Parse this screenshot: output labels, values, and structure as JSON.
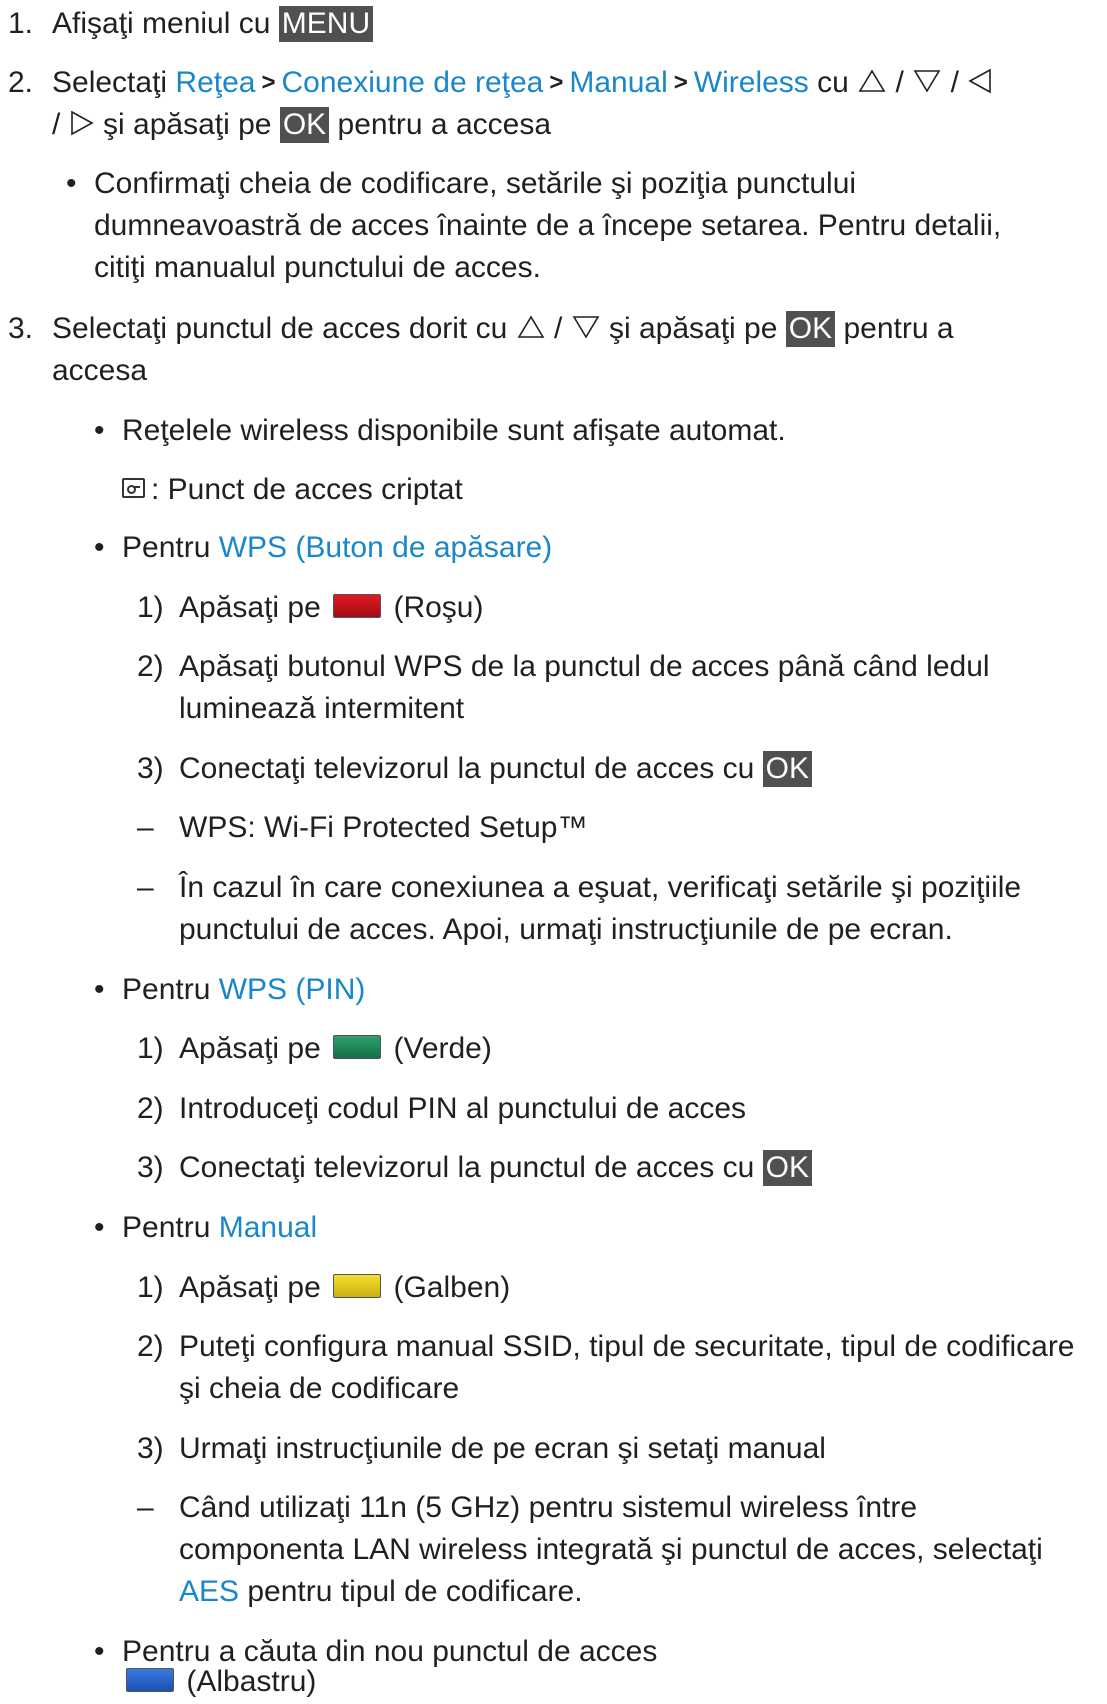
{
  "step1": {
    "num": "1.",
    "text": "Afişaţi meniul cu",
    "key": "MENU"
  },
  "step2": {
    "num": "2.",
    "prefix": "Selectaţi",
    "path": [
      "Reţea",
      "Conexiune de reţea",
      "Manual",
      "Wireless"
    ],
    "sep": ">",
    "cu": "cu",
    "slash": "/",
    "line2_pre": "şi apăsaţi pe",
    "ok": "OK",
    "line2_post": "pentru a accesa",
    "bullet": {
      "mark": "•",
      "lines": [
        "Confirmaţi cheia de codificare, setările şi poziţia punctului",
        "dumneavoastră de acces înainte de a începe setarea. Pentru detalii,",
        "citiţi manualul punctului de acces."
      ]
    }
  },
  "step3": {
    "num": "3.",
    "pre": "Selectaţi punctul de acces dorit cu",
    "slash": "/",
    "mid": "şi apăsaţi pe",
    "ok": "OK",
    "post": "pentru a",
    "line2": "accesa",
    "bullet_mark": "•",
    "dash_mark": "–",
    "b1": "Reţelele wireless disponibile sunt afişate automat.",
    "b1_sub": ": Punct de acces criptat",
    "b2_pre": "Pentru",
    "b2_link": "WPS (Buton de apăsare)",
    "b2_s1_num": "1)",
    "b2_s1_pre": "Apăsaţi pe",
    "b2_s1_post": "(Roşu)",
    "b2_s2_num": "2)",
    "b2_s2_l1": "Apăsaţi butonul WPS de la punctul de acces până când ledul",
    "b2_s2_l2": "luminează intermitent",
    "b2_s3_num": "3)",
    "b2_s3_pre": "Conectaţi televizorul la punctul de acces cu",
    "b2_s3_ok": "OK",
    "b2_d1": "WPS: Wi-Fi Protected Setup™",
    "b2_d2_l1": "În cazul în care conexiunea a eşuat, verificaţi setările şi poziţiile",
    "b2_d2_l2": "punctului de acces. Apoi, urmaţi instrucţiunile de pe ecran.",
    "b3_pre": "Pentru",
    "b3_link": "WPS (PIN)",
    "b3_s1_num": "1)",
    "b3_s1_pre": "Apăsaţi pe",
    "b3_s1_post": "(Verde)",
    "b3_s2_num": "2)",
    "b3_s2": "Introduceţi codul PIN al punctului de acces",
    "b3_s3_num": "3)",
    "b3_s3_pre": "Conectaţi televizorul la punctul de acces cu",
    "b3_s3_ok": "OK",
    "b4_pre": "Pentru",
    "b4_link": "Manual",
    "b4_s1_num": "1)",
    "b4_s1_pre": "Apăsaţi pe",
    "b4_s1_post": "(Galben)",
    "b4_s2_num": "2)",
    "b4_s2_l1": "Puteţi configura manual SSID, tipul de securitate, tipul de codificare",
    "b4_s2_l2": "şi cheia de codificare",
    "b4_s3_num": "3)",
    "b4_s3": "Urmaţi instrucţiunile de pe ecran şi setaţi manual",
    "b4_d1_l1": "Când utilizaţi 11n (5 GHz) pentru sistemul wireless între",
    "b4_d1_l2": "componenta LAN wireless integrată şi punctul de acces, selectaţi",
    "b4_d1_l3_link": "AES",
    "b4_d1_l3_post": "pentru tipul de codificare.",
    "b5": "Pentru a căuta din nou punctul de acces",
    "b5_sub": "(Albastru)"
  },
  "colors": {
    "link": "#1a87c9",
    "key_bg": "#505050",
    "red_button": "#c8141c",
    "green_button": "#1f8a5a",
    "yellow_button": "#e8d020",
    "blue_button": "#2a6ad0"
  },
  "icons": [
    "up-triangle-icon",
    "down-triangle-icon",
    "left-triangle-icon",
    "right-triangle-icon",
    "lock-icon"
  ]
}
